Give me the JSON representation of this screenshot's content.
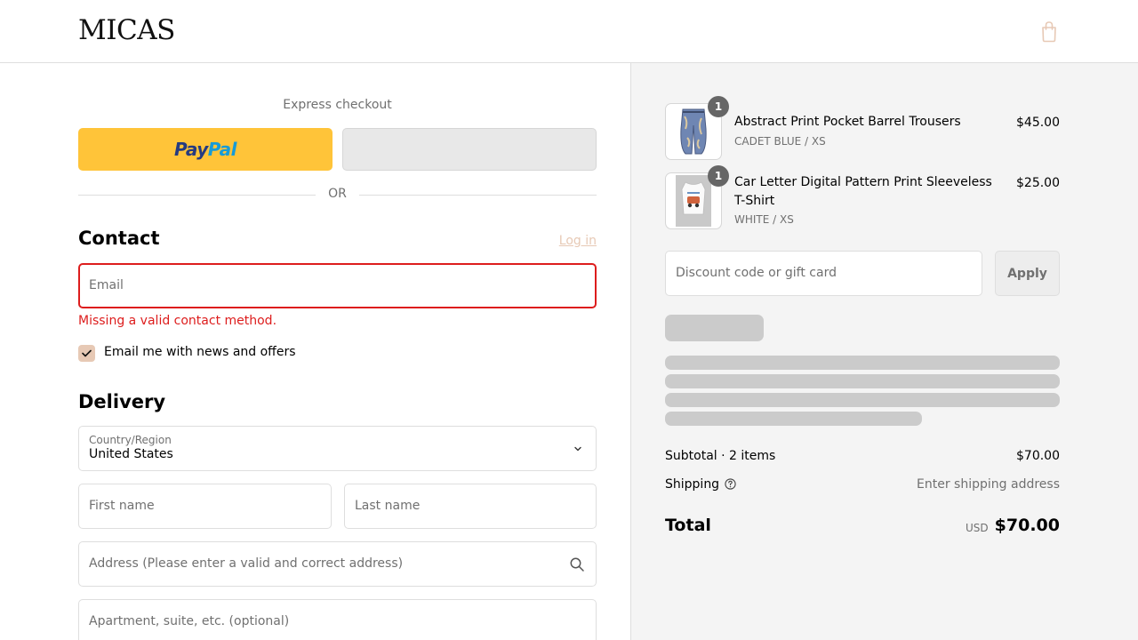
{
  "header": {
    "logo": "MICAS",
    "cart_icon": "shopping-bag-icon"
  },
  "express": {
    "label": "Express checkout",
    "paypal_pay": "Pay",
    "paypal_pal": "Pal",
    "or_label": "OR"
  },
  "contact": {
    "title": "Contact",
    "login_label": "Log in",
    "email_placeholder": "Email",
    "error": "Missing a valid contact method.",
    "newsletter_label": "Email me with news and offers",
    "newsletter_checked": true
  },
  "delivery": {
    "title": "Delivery",
    "country_label": "Country/Region",
    "country_value": "United States",
    "first_name_placeholder": "First name",
    "last_name_placeholder": "Last name",
    "address_placeholder": "Address (Please enter a valid and correct address)",
    "apartment_placeholder": "Apartment, suite, etc. (optional)"
  },
  "order": {
    "items": [
      {
        "quantity": "1",
        "name": "Abstract Print Pocket Barrel Trousers",
        "variant": "CADET BLUE / XS",
        "price": "$45.00"
      },
      {
        "quantity": "1",
        "name": "Car Letter Digital Pattern Print Sleeveless T-Shirt",
        "variant": "WHITE / XS",
        "price": "$25.00"
      }
    ],
    "discount_placeholder": "Discount code or gift card",
    "apply_label": "Apply",
    "subtotal_label": "Subtotal · 2 items",
    "subtotal_value": "$70.00",
    "shipping_label": "Shipping",
    "shipping_value": "Enter shipping address",
    "total_label": "Total",
    "total_currency": "USD",
    "total_value": "$70.00"
  },
  "colors": {
    "accent": "#e7c9b5",
    "error": "#dd1d1d",
    "paypal_yellow": "#ffc439"
  }
}
